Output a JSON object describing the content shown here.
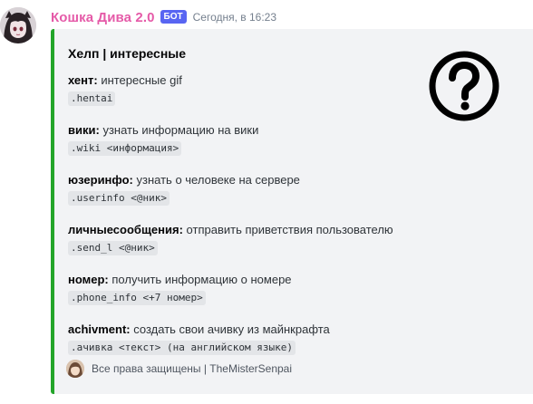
{
  "message": {
    "username": "Кошка Дива 2.0",
    "username_color": "#e55aa8",
    "bot_tag": "БОТ",
    "timestamp": "Сегодня, в 16:23",
    "avatar_icon": "anime-girl-avatar"
  },
  "embed": {
    "accent_color": "#23a52a",
    "title": "Хелп | интересные",
    "thumbnail_icon": "question-mark-circle-icon",
    "fields": [
      {
        "name": "хент:",
        "value": "интересные gif",
        "code": ".hentai"
      },
      {
        "name": "вики:",
        "value": "узнать информацию на вики",
        "code": ".wiki <информация>"
      },
      {
        "name": "юзеринфо:",
        "value": "узнать о человеке на сервере",
        "code": ".userinfo <@ник>"
      },
      {
        "name": "личныесообщения:",
        "value": "отправить приветствия пользователю",
        "code": ".send_l <@ник>"
      },
      {
        "name": "номер:",
        "value": "получить информацию о номере",
        "code": ".phone_info <+7 номер>"
      },
      {
        "name": "achivment:",
        "value": "создать свои ачивку из майнкрафта",
        "code": ".ачивка <текст> (на английском языке)"
      }
    ],
    "footer": {
      "icon": "footer-avatar-icon",
      "text": "Все права защищены | TheMisterSenpai"
    }
  }
}
